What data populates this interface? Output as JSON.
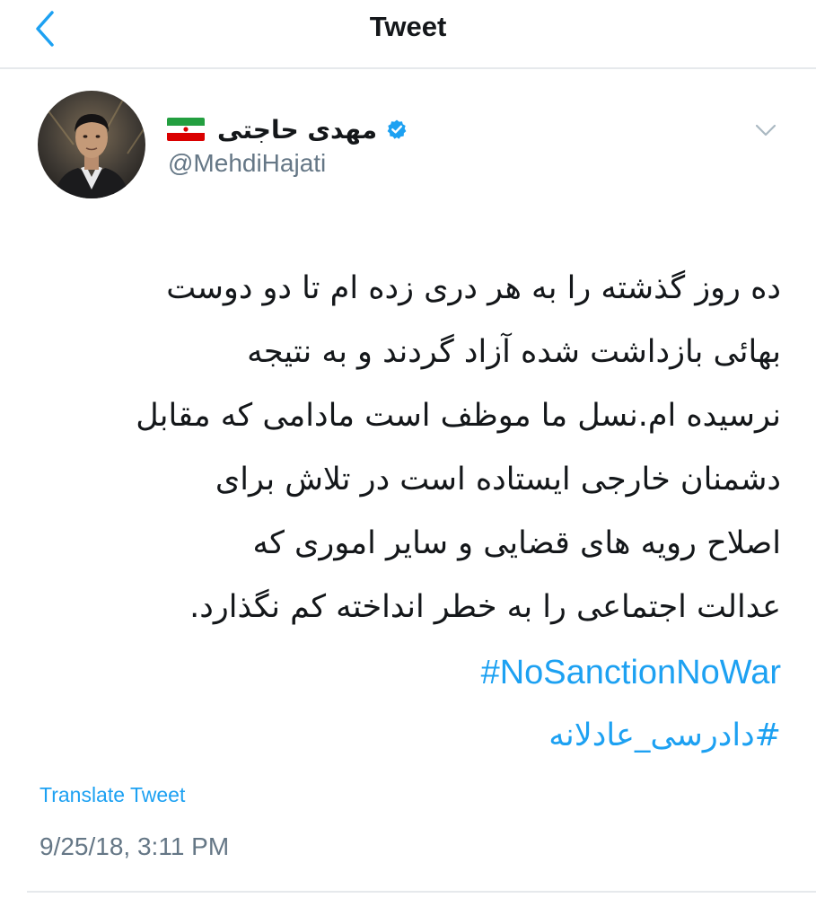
{
  "header": {
    "title": "Tweet",
    "back_icon": "chevron-left-icon"
  },
  "author": {
    "display_name": "مهدی حاجتی",
    "handle": "@MehdiHajati",
    "verified": true,
    "flag": "iran-flag"
  },
  "tweet": {
    "lines": [
      "ده روز گذشته را به هر دری زده ام تا دو دوست",
      "بهائی بازداشت شده آزاد گردند و به نتیجه",
      "نرسیده ام.نسل ما موظف است مادامی که مقابل",
      "دشمنان خارجی ایستاده است در تلاش برای",
      "اصلاح رویه های قضایی و سایر اموری که",
      "عدالت اجتماعی را به خطر انداخته کم نگذارد."
    ],
    "hashtags": [
      "#NoSanctionNoWar",
      "#دادرسی_عادلانه"
    ],
    "translate_label": "Translate Tweet",
    "timestamp": "9/25/18, 3:11 PM"
  },
  "colors": {
    "link": "#1da1f2",
    "secondary_text": "#657786",
    "primary_text": "#14171a",
    "divider": "#e6e9ec"
  }
}
